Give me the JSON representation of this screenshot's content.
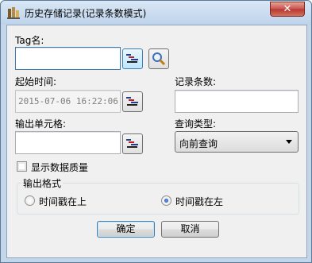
{
  "window": {
    "title": "历史存储记录(记录条数模式)",
    "close_label": "✕"
  },
  "form": {
    "tag_label": "Tag名:",
    "tag_value": "",
    "start_time_label": "起始时间:",
    "start_time_value": "2015-07-06 16:22:06",
    "record_count_label": "记录条数:",
    "record_count_value": "",
    "output_cell_label": "输出单元格:",
    "output_cell_value": "",
    "query_type_label": "查询类型:",
    "query_type_selected": "向前查询",
    "show_quality_label": "显示数据质量",
    "show_quality_checked": false
  },
  "output_format": {
    "title": "输出格式",
    "options": [
      {
        "label": "时间戳在上",
        "checked": false
      },
      {
        "label": "时间戳在左",
        "checked": true
      }
    ]
  },
  "buttons": {
    "ok_label": "确定",
    "cancel_label": "取消"
  },
  "icons": {
    "app": "app-icon",
    "pick": "tag-picker-icon",
    "search": "magnifier-icon"
  },
  "colors": {
    "title_bar": "#c4d6ea",
    "close_button": "#c75050",
    "client_bg": "#f0f0f0"
  }
}
